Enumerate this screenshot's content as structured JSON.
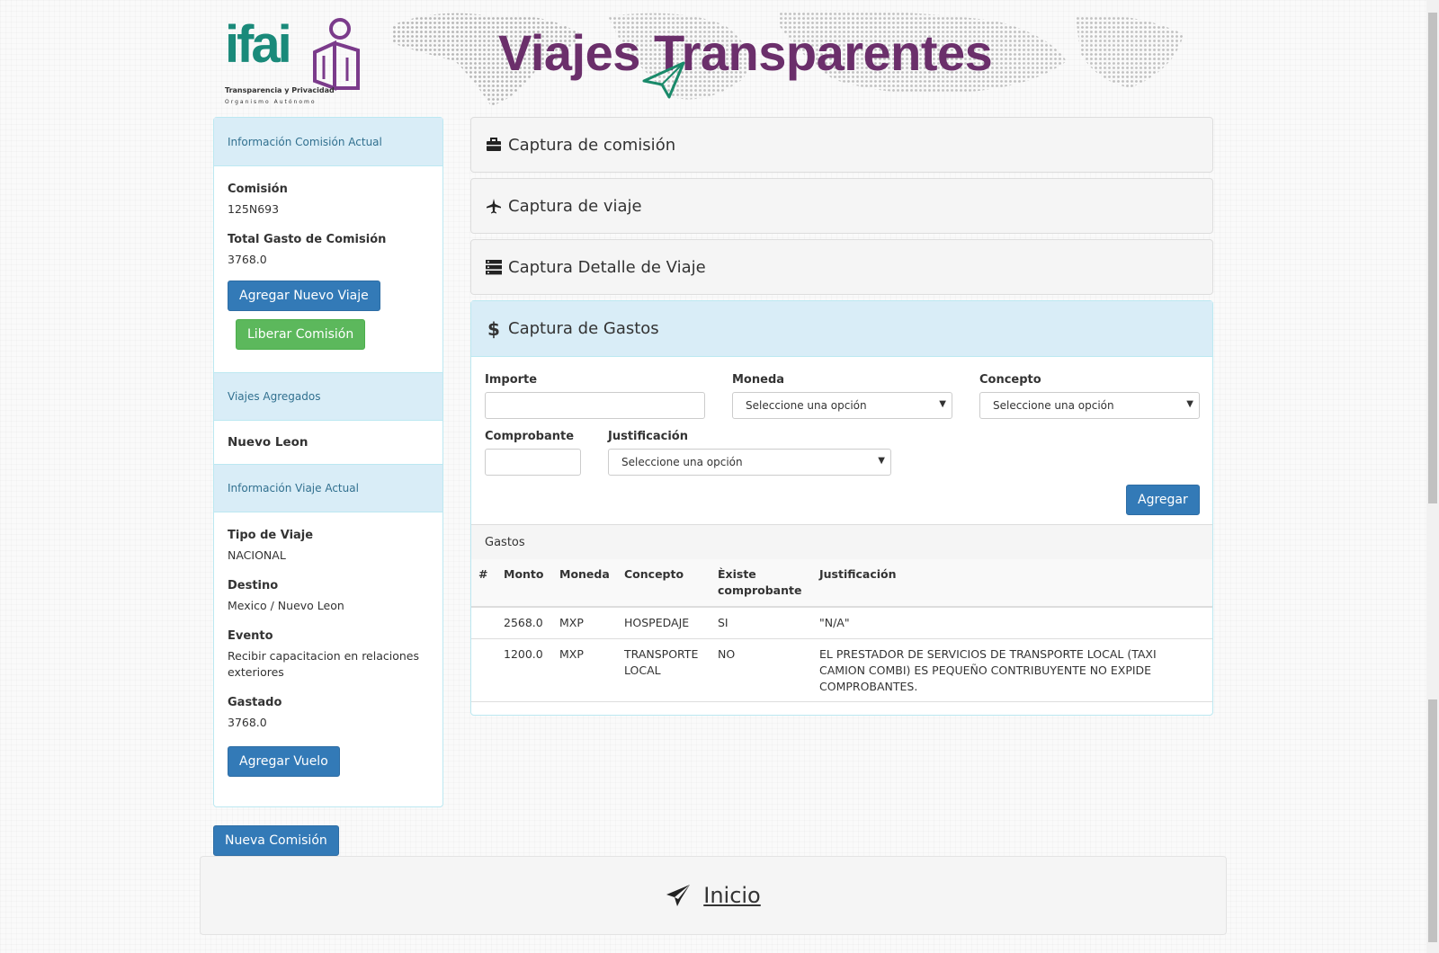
{
  "header": {
    "logo_main": "ifai",
    "logo_sub": "Transparencia y Privacidad",
    "logo_sub2": "Organismo Autónomo",
    "banner_title": "Viajes Transparentes"
  },
  "sidebar": {
    "info_comision_title": "Información Comisión Actual",
    "comision_label": "Comisión",
    "comision_value": "125N693",
    "total_label": "Total Gasto de Comisión",
    "total_value": "3768.0",
    "btn_agregar_viaje": "Agregar Nuevo Viaje",
    "btn_liberar": "Liberar Comisión",
    "viajes_title": "Viajes Agregados",
    "viaje_item": "Nuevo Leon",
    "info_viaje_title": "Información Viaje Actual",
    "tipo_label": "Tipo de Viaje",
    "tipo_value": "NACIONAL",
    "destino_label": "Destino",
    "destino_value": "Mexico / Nuevo Leon",
    "evento_label": "Evento",
    "evento_value": "Recibir capacitacion en relaciones exteriores",
    "gastado_label": "Gastado",
    "gastado_value": "3768.0",
    "btn_agregar_vuelo": "Agregar Vuelo"
  },
  "btn_nueva_comision": "Nueva Comisión",
  "accordion": {
    "comision": "Captura de comisión",
    "viaje": "Captura de viaje",
    "detalle": "Captura Detalle de Viaje",
    "gastos": "Captura de Gastos"
  },
  "form": {
    "importe_label": "Importe",
    "moneda_label": "Moneda",
    "moneda_value": "Seleccione una opción",
    "concepto_label": "Concepto",
    "concepto_value": "Seleccione una opción",
    "comprobante_label": "Comprobante",
    "justificacion_label": "Justificación",
    "justificacion_value": "Seleccione una opción",
    "btn_agregar": "Agregar"
  },
  "table": {
    "title": "Gastos",
    "headers": [
      "#",
      "Monto",
      "Moneda",
      "Concepto",
      "Èxiste comprobante",
      "Justificación"
    ],
    "rows": [
      {
        "num": "",
        "monto": "2568.0",
        "moneda": "MXP",
        "concepto": "HOSPEDAJE",
        "comprobante": "SI",
        "justificacion": "\"N/A\""
      },
      {
        "num": "",
        "monto": "1200.0",
        "moneda": "MXP",
        "concepto": "TRANSPORTE LOCAL",
        "comprobante": "NO",
        "justificacion": "EL PRESTADOR DE SERVICIOS DE TRANSPORTE LOCAL (TAXI CAMION COMBI) ES PEQUEÑO CONTRIBUYENTE NO EXPIDE COMPROBANTES."
      }
    ]
  },
  "footer": {
    "link": "Inicio"
  },
  "colors": {
    "primary": "#337ab7",
    "success": "#5cb85c",
    "info_bg": "#d9edf7",
    "brand_purple": "#6b2f6b",
    "brand_teal": "#1a8a7a"
  }
}
